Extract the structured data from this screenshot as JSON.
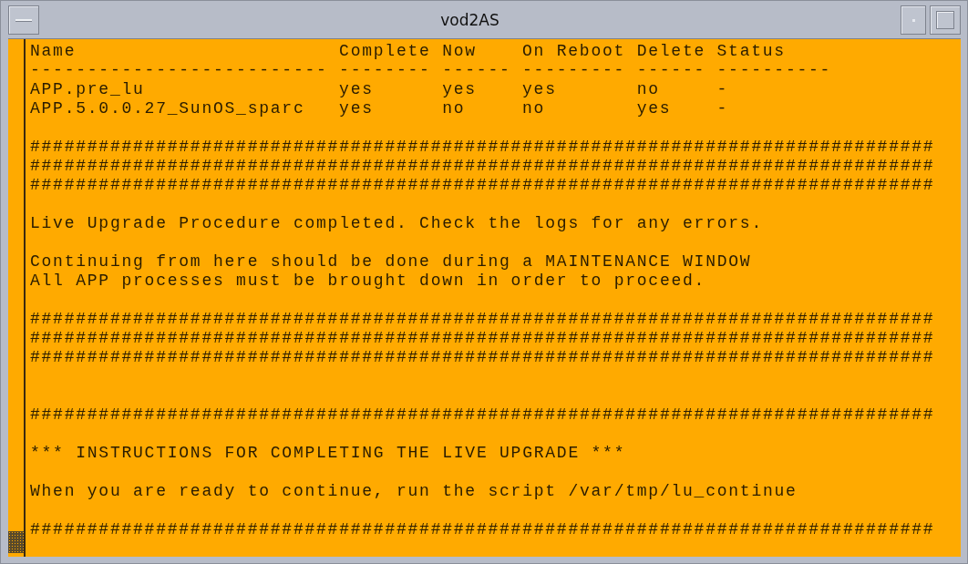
{
  "window": {
    "title": "vod2AS"
  },
  "table": {
    "columns": [
      {
        "header": "Name",
        "rule": "--------------------------"
      },
      {
        "header": "Complete",
        "rule": "--------"
      },
      {
        "header": "Now",
        "rule": "------"
      },
      {
        "header": "On Reboot",
        "rule": "---------"
      },
      {
        "header": "Delete",
        "rule": "------"
      },
      {
        "header": "Status",
        "rule": "----------"
      }
    ],
    "rows": [
      [
        "APP.pre_lu",
        "yes",
        "yes",
        "yes",
        "no",
        "-"
      ],
      [
        "APP.5.0.0.27_SunOS_sparc",
        "yes",
        "no",
        "no",
        "yes",
        "-"
      ]
    ]
  },
  "lines": [
    {
      "kind": "blank"
    },
    {
      "kind": "text",
      "text": "###############################################################################"
    },
    {
      "kind": "text",
      "text": "###############################################################################"
    },
    {
      "kind": "text",
      "text": "###############################################################################"
    },
    {
      "kind": "blank"
    },
    {
      "kind": "text",
      "text": "Live Upgrade Procedure completed. Check the logs for any errors."
    },
    {
      "kind": "blank"
    },
    {
      "kind": "text",
      "text": "Continuing from here should be done during a MAINTENANCE WINDOW"
    },
    {
      "kind": "text",
      "text": "All APP processes must be brought down in order to proceed."
    },
    {
      "kind": "blank"
    },
    {
      "kind": "text",
      "text": "###############################################################################"
    },
    {
      "kind": "text",
      "text": "###############################################################################"
    },
    {
      "kind": "text",
      "text": "###############################################################################"
    },
    {
      "kind": "blank"
    },
    {
      "kind": "blank"
    },
    {
      "kind": "text",
      "text": "###############################################################################"
    },
    {
      "kind": "blank"
    },
    {
      "kind": "text",
      "text": "*** INSTRUCTIONS FOR COMPLETING THE LIVE UPGRADE ***"
    },
    {
      "kind": "blank"
    },
    {
      "kind": "text",
      "text": "When you are ready to continue, run the script /var/tmp/lu_continue"
    },
    {
      "kind": "blank"
    },
    {
      "kind": "text",
      "text": "###############################################################################"
    }
  ]
}
